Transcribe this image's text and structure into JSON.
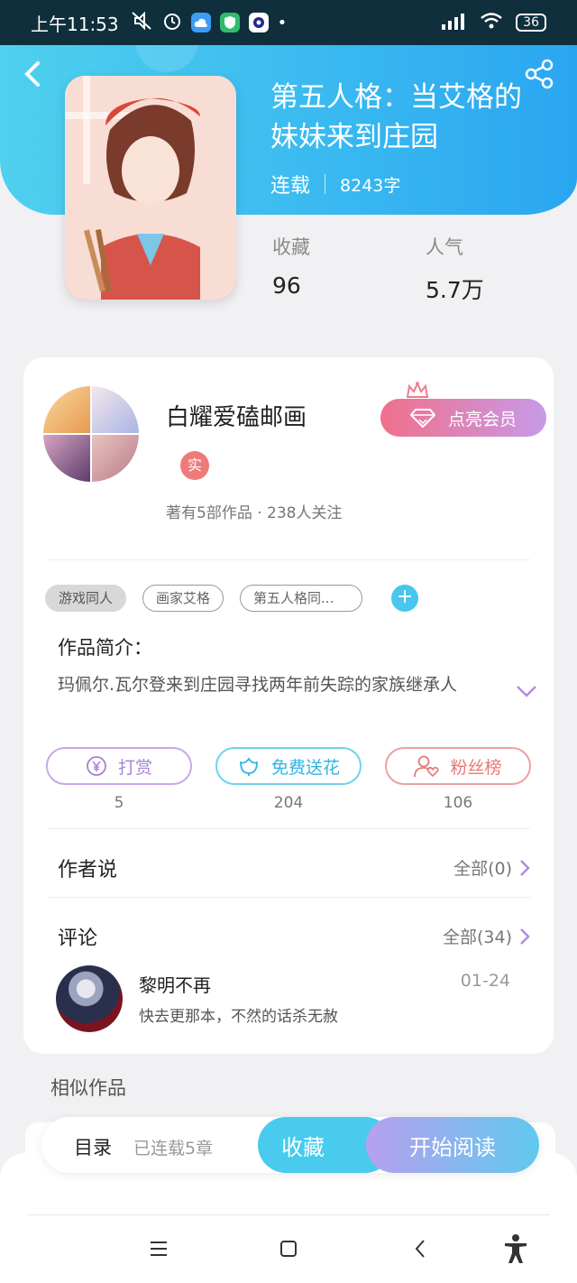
{
  "status_bar": {
    "time": "上午11:53",
    "battery": "36"
  },
  "book": {
    "title": "第五人格：当艾格的妹妹来到庄园",
    "status": "连载",
    "word_count": "8243字",
    "stats": [
      {
        "label": "收藏",
        "value": "96"
      },
      {
        "label": "人气",
        "value": "5.7万"
      }
    ]
  },
  "author": {
    "name": "白耀爱磕邮画",
    "verified_badge": "实",
    "summary": "著有5部作品 · 238人关注",
    "vip_button": "点亮会员"
  },
  "tags": [
    "游戏同人",
    "画家艾格",
    "第五人格同..."
  ],
  "intro": {
    "title": "作品简介：",
    "text": "玛佩尔.瓦尔登来到庄园寻找两年前失踪的家族继承人"
  },
  "actions": [
    {
      "label": "打赏",
      "count": "5",
      "color": "#b48ee0"
    },
    {
      "label": "免费送花",
      "count": "204",
      "color": "#45c7ee"
    },
    {
      "label": "粉丝榜",
      "count": "106",
      "color": "#ef8a8a"
    }
  ],
  "author_says": {
    "title": "作者说",
    "link": "全部(0)"
  },
  "comments": {
    "title": "评论",
    "link": "全部(34)",
    "items": [
      {
        "user": "黎明不再",
        "date": "01-24",
        "text": "快去更那本，不然的话杀无赦"
      }
    ]
  },
  "similar": {
    "title": "相似作品"
  },
  "bottom_bar": {
    "toc": "目录",
    "toc_sub": "已连载5章",
    "favorite": "收藏",
    "read": "开始阅读"
  }
}
